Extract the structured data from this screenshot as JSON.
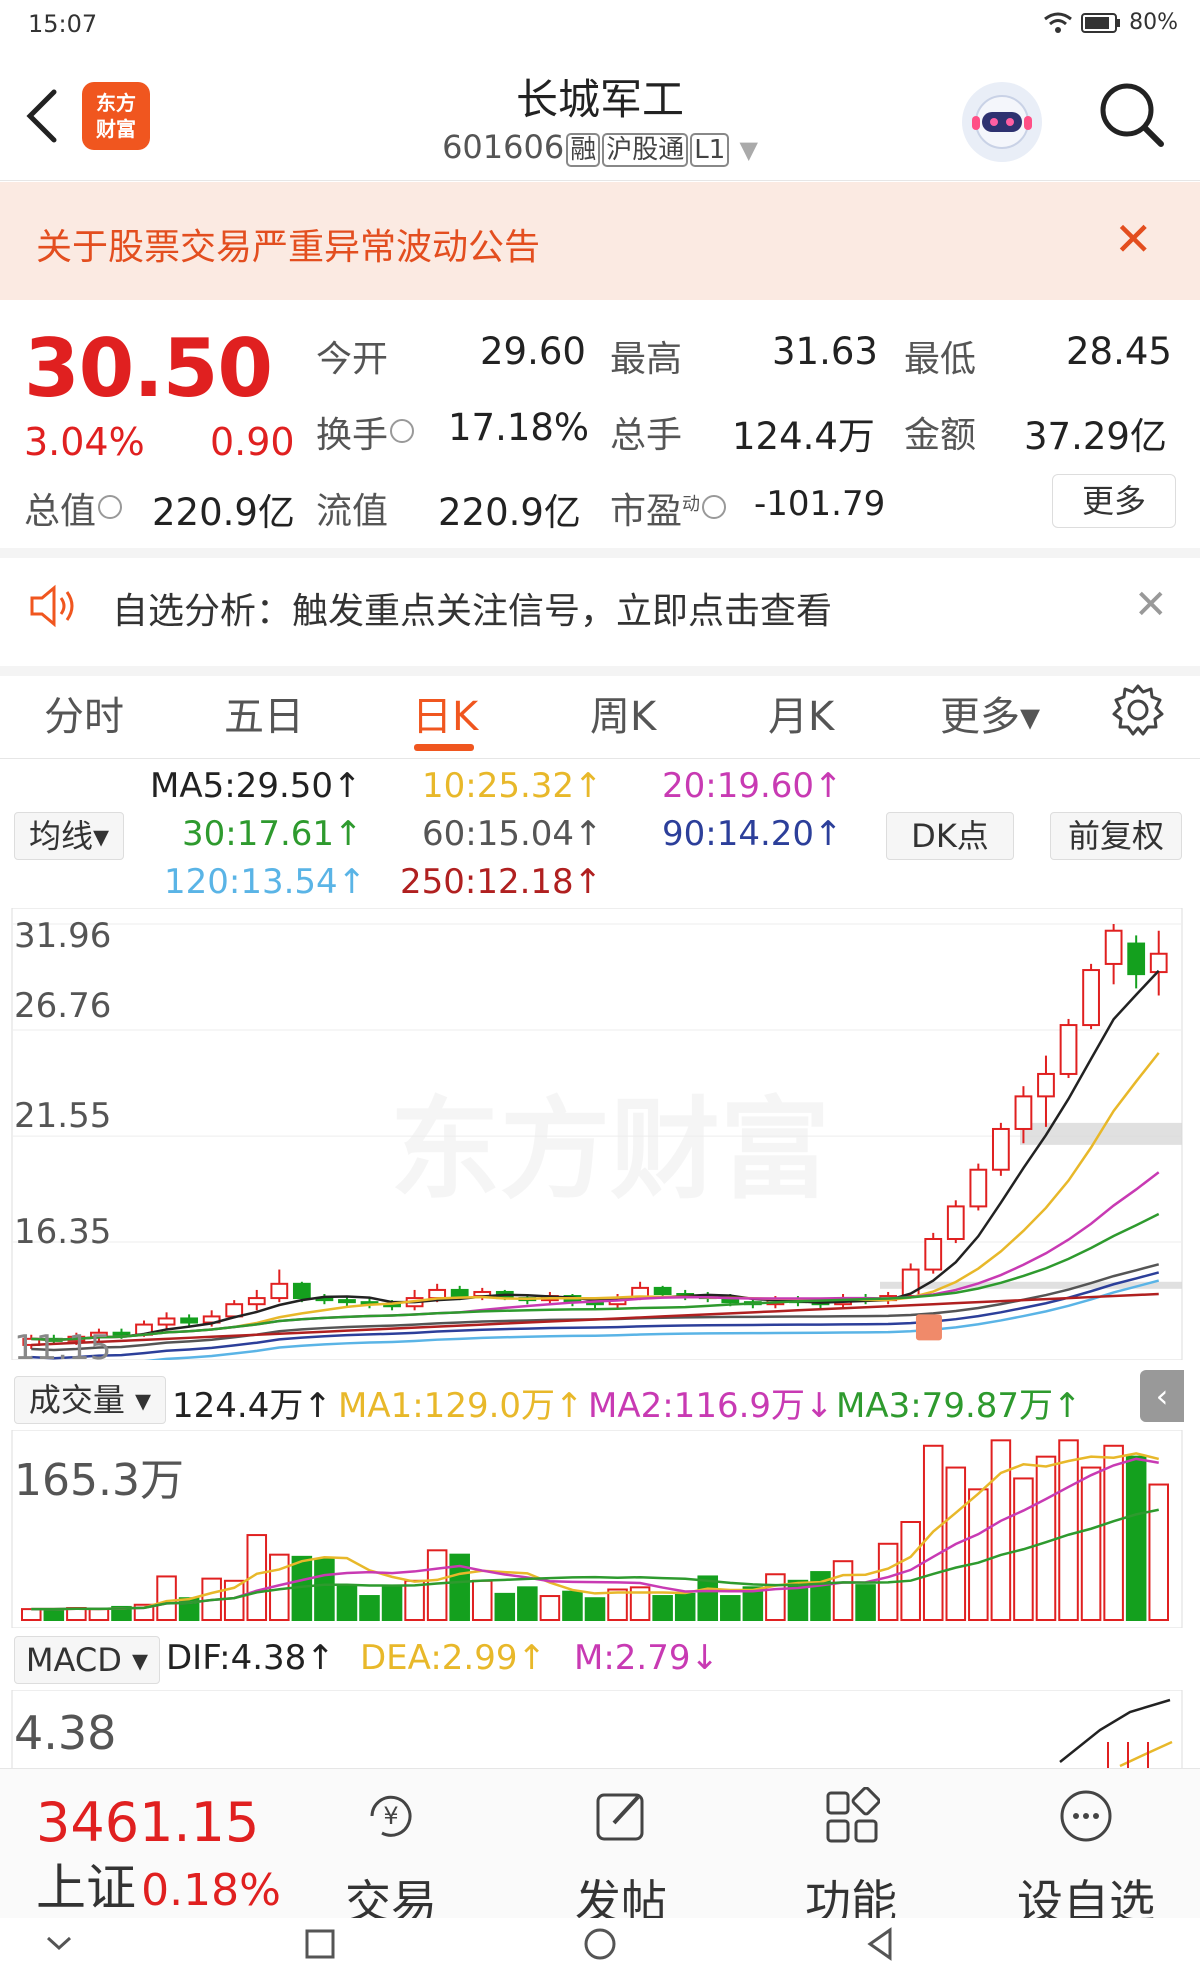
{
  "status_bar": {
    "time": "15:07",
    "battery": "80%"
  },
  "header": {
    "title": "长城军工",
    "code": "601606",
    "tags": [
      "融",
      "沪股通",
      "L1"
    ],
    "logo_text_1": "东方",
    "logo_text_2": "财富"
  },
  "notice": {
    "text": "关于股票交易严重异常波动公告"
  },
  "quote": {
    "price": "30.50",
    "pct": "3.04%",
    "change": "0.90",
    "open_label": "今开",
    "open": "29.60",
    "high_label": "最高",
    "high": "31.63",
    "low_label": "最低",
    "low": "28.45",
    "turnover_label": "换手",
    "turnover": "17.18%",
    "volume_label": "总手",
    "volume": "124.4万",
    "amount_label": "金额",
    "amount": "37.29亿",
    "mktcap_label": "总值",
    "mktcap": "220.9亿",
    "float_label": "流值",
    "float": "220.9亿",
    "pe_label": "市盈",
    "pe_sup": "动",
    "pe": "-101.79",
    "more": "更多"
  },
  "self_select": {
    "text": "自选分析：触发重点关注信号，立即点击查看"
  },
  "tabs": [
    "分时",
    "五日",
    "日K",
    "周K",
    "月K",
    "更多▾"
  ],
  "active_tab": "日K",
  "ma_legend": {
    "selector": "均线▾",
    "ma5": "MA5:29.50↑",
    "ma10": "10:25.32↑",
    "ma20": "20:19.60↑",
    "ma30": "30:17.61↑",
    "ma60": "60:15.04↑",
    "ma90": "90:14.20↑",
    "ma120": "120:13.54↑",
    "ma250": "250:12.18↑",
    "dk": "DK点",
    "fq": "前复权"
  },
  "kline_axis": [
    "31.96",
    "26.76",
    "21.55",
    "16.35",
    "11.15"
  ],
  "watermark": "东方财富",
  "volume_legend": {
    "selector": "成交量 ▾",
    "vol": "124.4万↑",
    "ma1": "MA1:129.0万↑",
    "ma2": "MA2:116.9万↓",
    "ma3": "MA3:79.87万↑",
    "max": "165.3万"
  },
  "macd_legend": {
    "selector": "MACD ▾",
    "dif": "DIF:4.38↑",
    "dea": "DEA:2.99↑",
    "m": "M:2.79↓",
    "max": "4.38"
  },
  "bottom": {
    "index_value": "3461.15",
    "index_name": "上证",
    "index_pct": "0.18%",
    "trade": "交易",
    "post": "发帖",
    "func": "功能",
    "add": "设自选"
  },
  "colors": {
    "up": "#e02020",
    "down": "#14a01e",
    "accent": "#f0561f",
    "ma5": "#222222",
    "ma10": "#e8b82a",
    "ma20": "#c83ab3",
    "ma30": "#2e9a2e",
    "ma60": "#555555",
    "ma90": "#2c3f9a",
    "ma120": "#5ab4e6",
    "ma250": "#b02020"
  },
  "chart_data": {
    "type": "candlestick",
    "y_range": [
      11.15,
      31.96
    ],
    "candles": [
      {
        "o": 11.3,
        "c": 11.6,
        "h": 11.8,
        "l": 11.1
      },
      {
        "o": 11.6,
        "c": 11.5,
        "h": 11.8,
        "l": 11.3
      },
      {
        "o": 11.5,
        "c": 11.7,
        "h": 11.9,
        "l": 11.3
      },
      {
        "o": 11.7,
        "c": 11.9,
        "h": 12.1,
        "l": 11.5
      },
      {
        "o": 11.9,
        "c": 11.8,
        "h": 12.1,
        "l": 11.6
      },
      {
        "o": 11.8,
        "c": 12.3,
        "h": 12.5,
        "l": 11.7
      },
      {
        "o": 12.3,
        "c": 12.6,
        "h": 12.9,
        "l": 12.1
      },
      {
        "o": 12.6,
        "c": 12.4,
        "h": 12.8,
        "l": 12.2
      },
      {
        "o": 12.4,
        "c": 12.7,
        "h": 13.0,
        "l": 12.2
      },
      {
        "o": 12.7,
        "c": 13.3,
        "h": 13.5,
        "l": 12.6
      },
      {
        "o": 13.3,
        "c": 13.6,
        "h": 14.0,
        "l": 13.0
      },
      {
        "o": 13.6,
        "c": 14.3,
        "h": 15.0,
        "l": 13.4
      },
      {
        "o": 14.3,
        "c": 13.6,
        "h": 14.4,
        "l": 13.4
      },
      {
        "o": 13.6,
        "c": 13.5,
        "h": 13.8,
        "l": 13.3
      },
      {
        "o": 13.5,
        "c": 13.4,
        "h": 13.7,
        "l": 13.2
      },
      {
        "o": 13.4,
        "c": 13.3,
        "h": 13.6,
        "l": 13.1
      },
      {
        "o": 13.3,
        "c": 13.2,
        "h": 13.5,
        "l": 13.0
      },
      {
        "o": 13.2,
        "c": 13.6,
        "h": 14.0,
        "l": 13.0
      },
      {
        "o": 13.6,
        "c": 14.0,
        "h": 14.3,
        "l": 13.4
      },
      {
        "o": 14.0,
        "c": 13.7,
        "h": 14.2,
        "l": 13.5
      },
      {
        "o": 13.7,
        "c": 13.9,
        "h": 14.1,
        "l": 13.5
      },
      {
        "o": 13.9,
        "c": 13.6,
        "h": 14.0,
        "l": 13.5
      },
      {
        "o": 13.6,
        "c": 13.5,
        "h": 13.8,
        "l": 13.3
      },
      {
        "o": 13.5,
        "c": 13.7,
        "h": 13.9,
        "l": 13.3
      },
      {
        "o": 13.7,
        "c": 13.4,
        "h": 13.8,
        "l": 13.2
      },
      {
        "o": 13.4,
        "c": 13.3,
        "h": 13.6,
        "l": 13.1
      },
      {
        "o": 13.3,
        "c": 13.6,
        "h": 13.8,
        "l": 13.1
      },
      {
        "o": 13.6,
        "c": 14.1,
        "h": 14.4,
        "l": 13.5
      },
      {
        "o": 14.1,
        "c": 13.8,
        "h": 14.2,
        "l": 13.6
      },
      {
        "o": 13.8,
        "c": 13.7,
        "h": 14.0,
        "l": 13.5
      },
      {
        "o": 13.7,
        "c": 13.6,
        "h": 13.9,
        "l": 13.4
      },
      {
        "o": 13.6,
        "c": 13.4,
        "h": 13.8,
        "l": 13.2
      },
      {
        "o": 13.4,
        "c": 13.3,
        "h": 13.6,
        "l": 13.1
      },
      {
        "o": 13.3,
        "c": 13.5,
        "h": 13.7,
        "l": 13.1
      },
      {
        "o": 13.5,
        "c": 13.4,
        "h": 13.7,
        "l": 13.2
      },
      {
        "o": 13.4,
        "c": 13.3,
        "h": 13.6,
        "l": 13.1
      },
      {
        "o": 13.3,
        "c": 13.6,
        "h": 13.8,
        "l": 13.1
      },
      {
        "o": 13.6,
        "c": 13.5,
        "h": 13.8,
        "l": 13.3
      },
      {
        "o": 13.5,
        "c": 13.7,
        "h": 13.9,
        "l": 13.3
      },
      {
        "o": 13.7,
        "c": 15.0,
        "h": 15.3,
        "l": 13.6
      },
      {
        "o": 15.0,
        "c": 16.5,
        "h": 16.8,
        "l": 14.8
      },
      {
        "o": 16.5,
        "c": 18.1,
        "h": 18.4,
        "l": 16.3
      },
      {
        "o": 18.1,
        "c": 19.9,
        "h": 20.2,
        "l": 17.9
      },
      {
        "o": 19.9,
        "c": 21.9,
        "h": 22.2,
        "l": 19.6
      },
      {
        "o": 21.9,
        "c": 23.5,
        "h": 24.0,
        "l": 21.2
      },
      {
        "o": 23.5,
        "c": 24.6,
        "h": 25.5,
        "l": 22.0
      },
      {
        "o": 24.6,
        "c": 27.0,
        "h": 27.3,
        "l": 24.4
      },
      {
        "o": 27.0,
        "c": 29.7,
        "h": 30.0,
        "l": 26.8
      },
      {
        "o": 30.0,
        "c": 31.63,
        "h": 31.96,
        "l": 29.0
      },
      {
        "o": 31.0,
        "c": 29.5,
        "h": 31.4,
        "l": 28.8
      },
      {
        "o": 29.6,
        "c": 30.5,
        "h": 31.63,
        "l": 28.45
      }
    ],
    "volume_max": 165.3,
    "volumes": [
      10,
      10,
      11,
      10,
      12,
      14,
      40,
      20,
      38,
      36,
      78,
      60,
      58,
      56,
      32,
      22,
      30,
      36,
      64,
      60,
      36,
      24,
      30,
      22,
      26,
      20,
      28,
      30,
      22,
      24,
      40,
      22,
      30,
      42,
      36,
      44,
      54,
      32,
      70,
      90,
      160,
      140,
      120,
      165,
      130,
      150,
      165,
      140,
      160,
      150,
      124.4
    ],
    "macd_max": 4.38
  }
}
